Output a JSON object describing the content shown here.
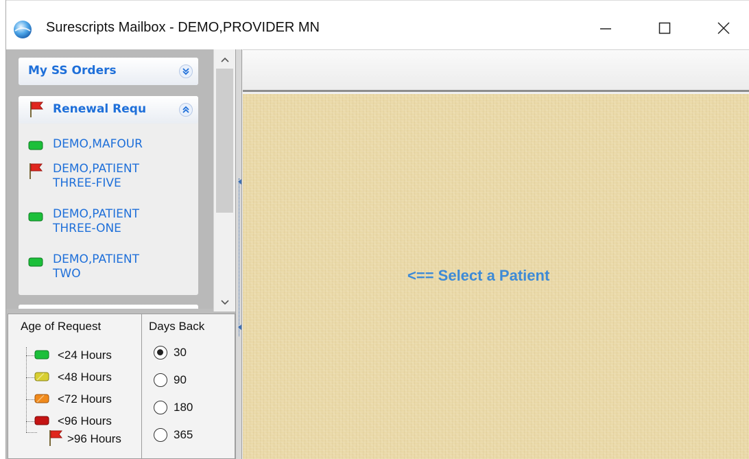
{
  "window": {
    "title": "Surescripts Mailbox - DEMO,PROVIDER MN",
    "minimize_glyph": "—",
    "maximize_glyph": "☐",
    "close_glyph": "✕"
  },
  "nav": {
    "groups": [
      {
        "title": "My SS Orders",
        "icon": "none",
        "state": "collapsed"
      },
      {
        "title": "Renewal Requ",
        "icon": "red-flag-icon",
        "state": "expanded",
        "items": [
          {
            "name": "DEMO,MAFOUR",
            "status_icon": "green-status-icon"
          },
          {
            "name": "DEMO,PATIENT\nTHREE-FIVE",
            "status_icon": "red-flag-icon"
          },
          {
            "name": "DEMO,PATIENT\nTHREE-ONE",
            "status_icon": "green-status-icon"
          },
          {
            "name": "DEMO,PATIENT\nTWO",
            "status_icon": "green-status-icon"
          }
        ]
      }
    ]
  },
  "legend": {
    "age_title": "Age of Request",
    "age_items": [
      {
        "label": "<24 Hours",
        "color": "#1cbf3a",
        "icon": "green-status-icon"
      },
      {
        "label": "<48 Hours",
        "color": "#d8cf32",
        "icon": "yellow-status-icon"
      },
      {
        "label": "<72 Hours",
        "color": "#f08a1c",
        "icon": "orange-status-icon"
      },
      {
        "label": "<96 Hours",
        "color": "#c41414",
        "icon": "red-status-icon"
      },
      {
        "label": ">96 Hours",
        "color": "#d42020",
        "icon": "red-flag-icon"
      }
    ],
    "days_title": "Days Back",
    "days_options": [
      {
        "label": "30",
        "checked": true
      },
      {
        "label": "90",
        "checked": false
      },
      {
        "label": "180",
        "checked": false
      },
      {
        "label": "365",
        "checked": false
      }
    ]
  },
  "main": {
    "message": "<== Select a Patient"
  },
  "colors": {
    "accent_blue": "#1e6fd9",
    "canvas": "#ead9a8",
    "message_blue": "#3d8ad6"
  }
}
